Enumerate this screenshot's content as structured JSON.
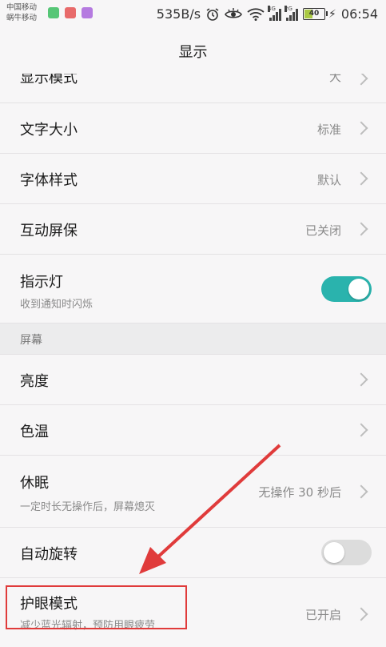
{
  "status": {
    "carrier1": "中国移动",
    "carrier2": "蜗牛移动",
    "speed": "535B/s",
    "net1": "4G",
    "net2": "2G",
    "battery": "40",
    "time": "06:54",
    "app_icon_colors": [
      "#56c676",
      "#e86a6a",
      "#b57ae0"
    ]
  },
  "header": {
    "title": "显示"
  },
  "items": {
    "partial": {
      "title": "显示模式",
      "value": "大"
    },
    "font_size": {
      "title": "文字大小",
      "value": "标准"
    },
    "font_style": {
      "title": "字体样式",
      "value": "默认"
    },
    "screensaver": {
      "title": "互动屏保",
      "value": "已关闭"
    },
    "indicator": {
      "title": "指示灯",
      "subtitle": "收到通知时闪烁",
      "toggle_on": true
    }
  },
  "section_screen": "屏幕",
  "screen_items": {
    "brightness": {
      "title": "亮度"
    },
    "color_temp": {
      "title": "色温"
    },
    "sleep": {
      "title": "休眠",
      "subtitle": "一定时长无操作后，屏幕熄灭",
      "value": "无操作 30 秒后"
    },
    "auto_rotate": {
      "title": "自动旋转",
      "toggle_on": false
    },
    "eye_care": {
      "title": "护眼模式",
      "subtitle": "减少蓝光辐射，预防用眼疲劳",
      "value": "已开启"
    }
  },
  "colors": {
    "toggle_on": "#2ab3ad",
    "toggle_off": "#dcdcdc",
    "highlight": "#e03b3b"
  }
}
